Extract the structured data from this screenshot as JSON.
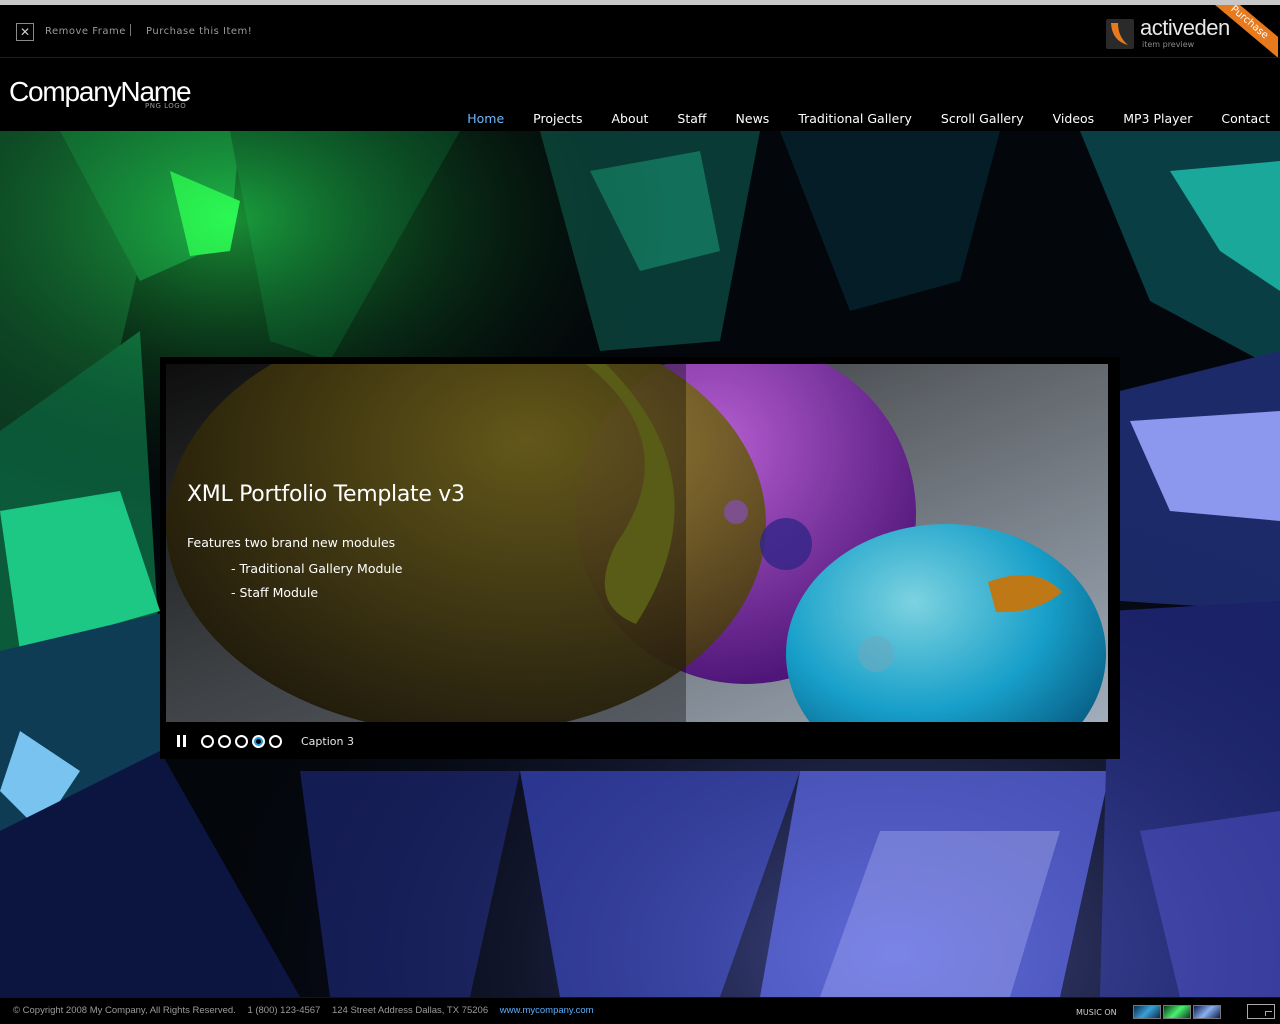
{
  "frame": {
    "remove_label": "Remove Frame",
    "purchase_label": "Purchase this Item!",
    "close_glyph": "✕",
    "badge_name": "activeden",
    "badge_sub": "item preview",
    "badge_ribbon": "Purchase"
  },
  "header": {
    "logo": "CompanyName",
    "logo_sub": "PNG LOGO"
  },
  "nav": {
    "items": [
      "Home",
      "Projects",
      "About",
      "Staff",
      "News",
      "Traditional Gallery",
      "Scroll Gallery",
      "Videos",
      "MP3 Player",
      "Contact"
    ],
    "active": "Home"
  },
  "slide": {
    "title": "XML Portfolio Template v3",
    "intro": "Features two brand new modules",
    "bullets": [
      "- Traditional Gallery Module",
      "- Staff Module"
    ],
    "caption": "Caption 3",
    "dot_count": 5,
    "active_dot": 4
  },
  "footer": {
    "copyright": "© Copyright 2008 My Company, All Rights Reserved.",
    "phone": "1 (800) 123-4567",
    "address": "124 Street Address Dallas, TX 75206",
    "website": "www.mycompany.com",
    "music_label": "MUSIC ON"
  },
  "colors": {
    "accent_nav": "#6db8ff",
    "active_dot": "#1a9ad6",
    "footer_link": "#5aaefc",
    "ribbon": "#e77a1d"
  }
}
